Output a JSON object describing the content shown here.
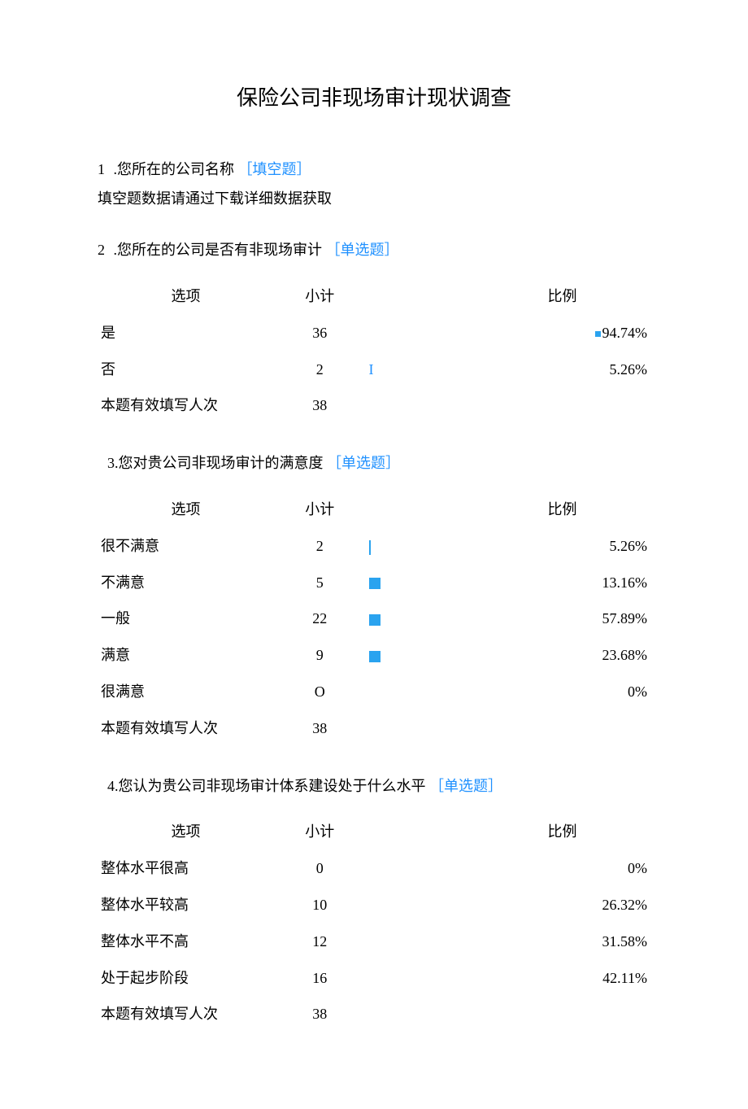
{
  "title": "保险公司非现场审计现状调查",
  "tags": {
    "fill": "［填空题］",
    "single": "［单选题］"
  },
  "headers": {
    "option": "选项",
    "subtotal": "小计",
    "ratio": "比例"
  },
  "q1": {
    "num": "1",
    "sep": ".",
    "text": "您所在的公司名称",
    "note": "填空题数据请通过下载详细数据获取"
  },
  "q2": {
    "num": "2",
    "sep": ".",
    "text": "您所在的公司是否有非现场审计",
    "rows": [
      {
        "option": "是",
        "count": "36",
        "pct": "94.74%",
        "bar": "square"
      },
      {
        "option": "否",
        "count": "2",
        "pct": "5.26%",
        "bar": "I"
      }
    ],
    "total_label": "本题有效填写人次",
    "total_count": "38"
  },
  "q3": {
    "num": "3",
    "sep": ".",
    "text": "您对贵公司非现场审计的满意度",
    "rows": [
      {
        "option": "很不满意",
        "count": "2",
        "pct": "5.26%",
        "bar": "line"
      },
      {
        "option": "不满意",
        "count": "5",
        "pct": "13.16%",
        "bar": "sq14"
      },
      {
        "option": "一般",
        "count": "22",
        "pct": "57.89%",
        "bar": "sq14"
      },
      {
        "option": "满意",
        "count": "9",
        "pct": "23.68%",
        "bar": "sq14"
      },
      {
        "option": "很满意",
        "count": "O",
        "pct": "0%",
        "bar": ""
      }
    ],
    "total_label": "本题有效填写人次",
    "total_count": "38"
  },
  "q4": {
    "num": "4",
    "sep": ".",
    "text": "您认为贵公司非现场审计体系建设处于什么水平",
    "rows": [
      {
        "option": "整体水平很高",
        "count": "0",
        "pct": "0%"
      },
      {
        "option": "整体水平较高",
        "count": "10",
        "pct": "26.32%"
      },
      {
        "option": "整体水平不高",
        "count": "12",
        "pct": "31.58%"
      },
      {
        "option": "处于起步阶段",
        "count": "16",
        "pct": "42.11%"
      }
    ],
    "total_label": "本题有效填写人次",
    "total_count": "38"
  }
}
